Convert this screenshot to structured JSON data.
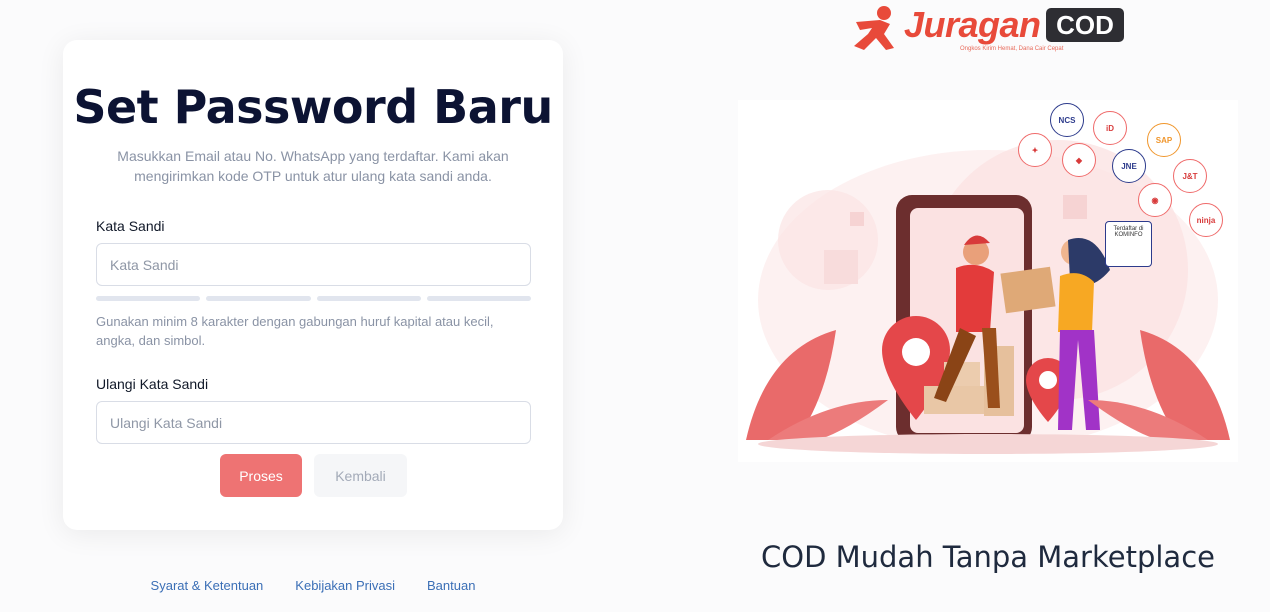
{
  "form": {
    "title": "Set Password Baru",
    "subtitle": "Masukkan Email atau No. WhatsApp yang terdaftar. Kami akan mengirimkan kode OTP untuk atur ulang kata sandi anda.",
    "password_label": "Kata Sandi",
    "password_placeholder": "Kata Sandi",
    "password_hint": "Gunakan minim 8 karakter dengan gabungan huruf kapital atau kecil, angka, dan simbol.",
    "confirm_label": "Ulangi Kata Sandi",
    "confirm_placeholder": "Ulangi Kata Sandi",
    "submit_label": "Proses",
    "back_label": "Kembali"
  },
  "footer": {
    "terms": "Syarat & Ketentuan",
    "privacy": "Kebijakan Privasi",
    "help": "Bantuan"
  },
  "brand": {
    "name": "Juragan",
    "suffix": "COD",
    "tagline_small": "Ongkos Kirim Hemat, Dana Cair Cepat",
    "accent_color": "#ee7373",
    "logo_color": "#e84a3a"
  },
  "hero": {
    "tagline": "COD Mudah Tanpa Marketplace",
    "badges": [
      "NCS",
      "ID Express",
      "SAP",
      "Lion Parcel",
      "Mobile",
      "JNE",
      "J&T",
      "Anteraja",
      "ninja"
    ],
    "kominfo": "Terdaftar di KOMINFO"
  }
}
